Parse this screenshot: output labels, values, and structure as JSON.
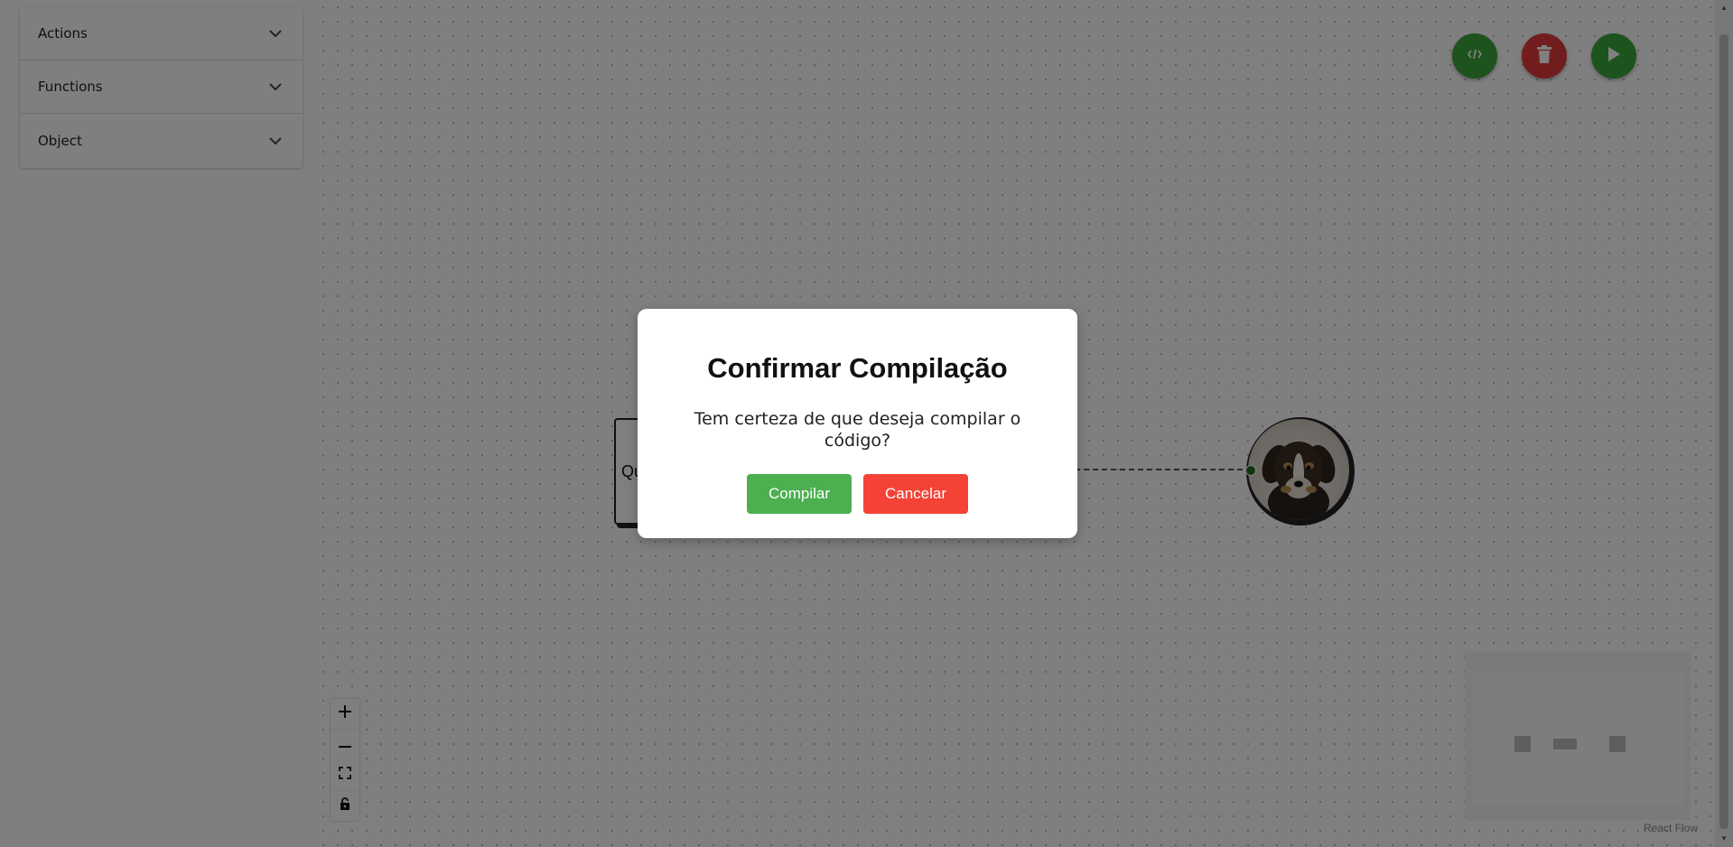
{
  "sidebar": {
    "items": [
      {
        "label": "Actions",
        "icon": "chevron-down-icon"
      },
      {
        "label": "Functions",
        "icon": "chevron-down-icon"
      },
      {
        "label": "Object",
        "icon": "chevron-down-icon"
      }
    ]
  },
  "canvas": {
    "node_text": "Qu",
    "toolbar": [
      {
        "name": "code-icon",
        "color": "#3aa63a"
      },
      {
        "name": "trash-icon",
        "color": "#e43b3b"
      },
      {
        "name": "play-icon",
        "color": "#3aa63a"
      }
    ],
    "controls": [
      "zoom-in-icon",
      "zoom-out-icon",
      "fit-view-icon",
      "lock-icon"
    ],
    "attribution": "React Flow"
  },
  "modal": {
    "title": "Confirmar Compilação",
    "message": "Tem certeza de que deseja compilar o código?",
    "confirm_label": "Compilar",
    "cancel_label": "Cancelar"
  },
  "colors": {
    "confirm": "#4caf50",
    "cancel": "#f44336",
    "overlay": "rgba(0,0,0,0.5)"
  }
}
